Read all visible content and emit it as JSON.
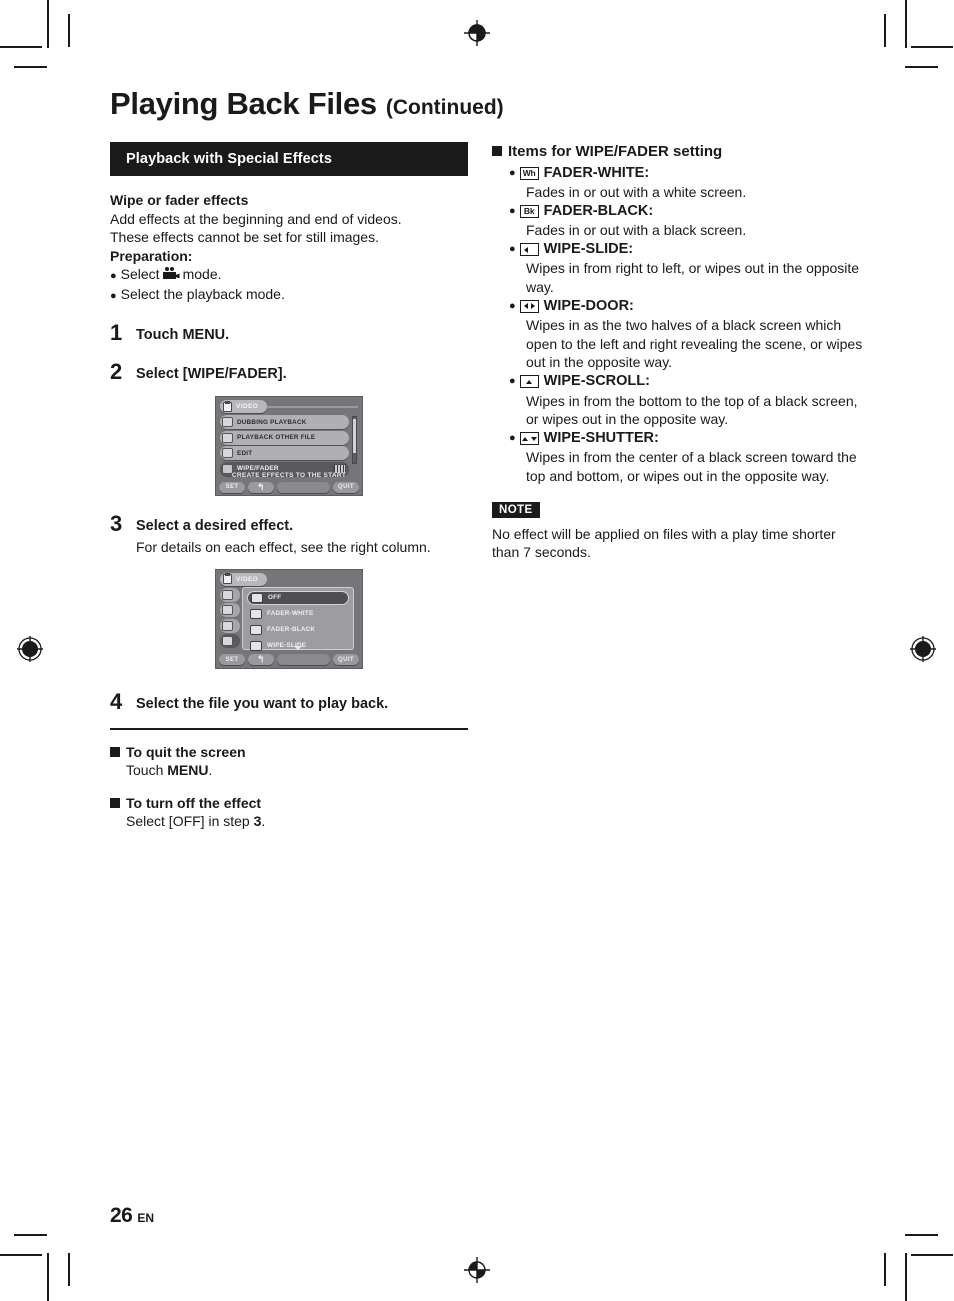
{
  "title": {
    "main": "Playing Back Files",
    "continued": "(Continued)"
  },
  "section_bar": {
    "label": "Playback with Special Effects"
  },
  "intro": {
    "heading": "Wipe or fader effects",
    "line1": "Add effects at the beginning and end of videos.",
    "line2": "These effects cannot be set for still images.",
    "prep_heading": "Preparation:",
    "prep_1_pre": "Select",
    "prep_1_post": "mode.",
    "prep_2": "Select the playback mode."
  },
  "steps": [
    {
      "num": "1",
      "title": "Touch MENU.",
      "text": ""
    },
    {
      "num": "2",
      "title": "Select [WIPE/FADER].",
      "text": ""
    },
    {
      "num": "3",
      "title": "Select a desired effect.",
      "text": "For details on each effect, see the right column."
    },
    {
      "num": "4",
      "title": "Select the file you want to play back.",
      "text": ""
    }
  ],
  "lcd_menu": {
    "tab_label": "VIDEO",
    "rows": [
      {
        "label": "DUBBING PLAYBACK",
        "selected": false,
        "right_icon": false
      },
      {
        "label": "PLAYBACK OTHER FILE",
        "selected": false,
        "right_icon": false
      },
      {
        "label": "EDIT",
        "selected": false,
        "right_icon": false
      },
      {
        "label": "WIPE/FADER",
        "selected": true,
        "right_icon": true
      }
    ],
    "hint": "CREATE EFFECTS TO THE START",
    "buttons": {
      "set": "SET",
      "back": "↰",
      "quit": "QUIT"
    }
  },
  "lcd_effects": {
    "tab_label": "VIDEO",
    "rows": [
      {
        "label": "OFF",
        "selected": true
      },
      {
        "label": "FADER-WHITE",
        "selected": false
      },
      {
        "label": "FADER-BLACK",
        "selected": false
      },
      {
        "label": "WIPE-SLIDE",
        "selected": false
      }
    ],
    "buttons": {
      "set": "SET",
      "back": "↰",
      "quit": "QUIT"
    }
  },
  "quit_section": {
    "heading": "To quit the screen",
    "text_pre": "Touch ",
    "text_bold": "MENU",
    "text_post": "."
  },
  "turnoff_section": {
    "heading": "To turn off the effect",
    "text_pre": "Select [OFF] in step ",
    "text_bold": "3",
    "text_post": "."
  },
  "right_column": {
    "heading": "Items for WIPE/FADER setting",
    "items": [
      {
        "icon": "badge-wh",
        "icon_text": "Wh",
        "name": "FADER-WHITE:",
        "desc": "Fades in or out with a white screen."
      },
      {
        "icon": "badge-bk",
        "icon_text": "Bk",
        "name": "FADER-BLACK:",
        "desc": "Fades in or out with a black screen."
      },
      {
        "icon": "badge-arrow-left",
        "icon_text": "",
        "name": "WIPE-SLIDE:",
        "desc": "Wipes in from right to left, or wipes out in the opposite way."
      },
      {
        "icon": "badge-arrow-left-right",
        "icon_text": "",
        "name": "WIPE-DOOR:",
        "desc": "Wipes in as the two halves of a black screen which open to the left and right revealing the scene, or wipes out in the opposite way."
      },
      {
        "icon": "badge-arrow-up",
        "icon_text": "",
        "name": "WIPE-SCROLL:",
        "desc": "Wipes in from the bottom to the top of a black screen, or wipes out in the opposite way."
      },
      {
        "icon": "badge-arrow-up-down",
        "icon_text": "",
        "name": "WIPE-SHUTTER:",
        "desc": "Wipes in from the center of a black screen toward the top and bottom, or wipes out in the opposite way."
      }
    ],
    "note_tag": "NOTE",
    "note_text": "No effect will be applied on files with a play time shorter than 7 seconds."
  },
  "footer": {
    "page_number": "26",
    "language": "EN"
  },
  "colors": {
    "ink": "#1a1a1a",
    "bar_bg": "#1a1a1a",
    "bar_text": "#ffffff",
    "lcd_bg": "#76767a"
  }
}
